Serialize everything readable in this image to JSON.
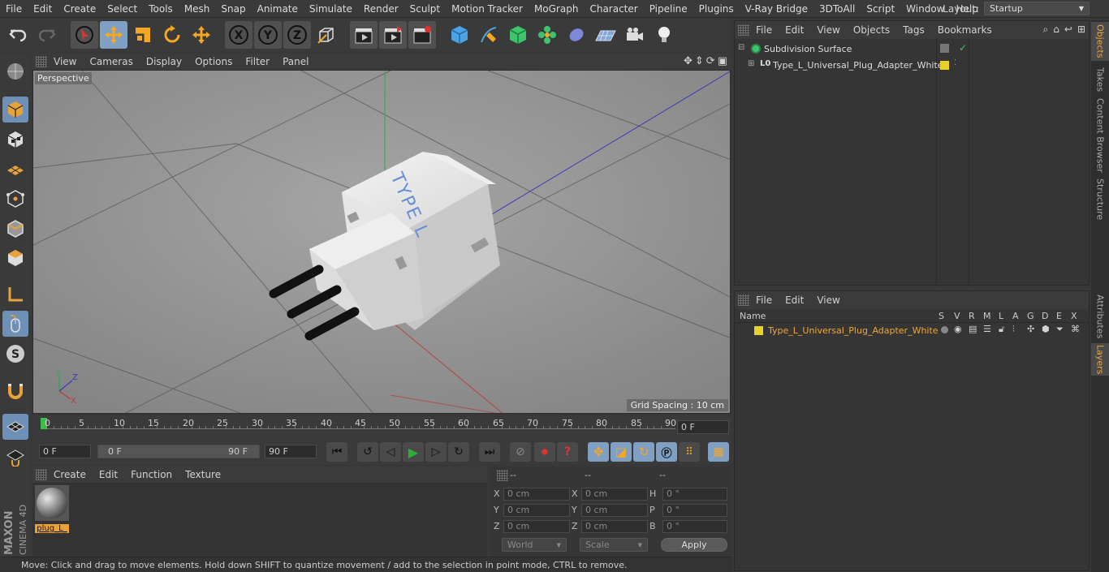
{
  "menu": [
    "File",
    "Edit",
    "Create",
    "Select",
    "Tools",
    "Mesh",
    "Snap",
    "Animate",
    "Simulate",
    "Render",
    "Sculpt",
    "Motion Tracker",
    "MoGraph",
    "Character",
    "Pipeline",
    "Plugins",
    "V-Ray Bridge",
    "3DToAll",
    "Script",
    "Window",
    "Help"
  ],
  "layout": {
    "label": "Layout:",
    "value": "Startup"
  },
  "viewport": {
    "menu": [
      "View",
      "Cameras",
      "Display",
      "Options",
      "Filter",
      "Panel"
    ],
    "label": "Perspective",
    "grid_spacing": "Grid Spacing : 10 cm",
    "model_text": "TYPE L",
    "axis": {
      "x": "X",
      "y": "Y",
      "z": "Z"
    }
  },
  "timeline": {
    "ticks": [
      "0",
      "5",
      "10",
      "15",
      "20",
      "25",
      "30",
      "35",
      "40",
      "45",
      "50",
      "55",
      "60",
      "65",
      "70",
      "75",
      "80",
      "85",
      "90"
    ],
    "current_frame": "0 F"
  },
  "transport": {
    "start": "0 F",
    "range_start": "0 F",
    "range_end": "90 F",
    "end": "90 F"
  },
  "material": {
    "menu": [
      "Create",
      "Edit",
      "Function",
      "Texture"
    ],
    "item": "plug_L_"
  },
  "coords": {
    "headers": [
      "--",
      "--",
      "--"
    ],
    "rows": [
      {
        "a": "X",
        "av": "0 cm",
        "b": "X",
        "bv": "0 cm",
        "c": "H",
        "cv": "0 °"
      },
      {
        "a": "Y",
        "av": "0 cm",
        "b": "Y",
        "bv": "0 cm",
        "c": "P",
        "cv": "0 °"
      },
      {
        "a": "Z",
        "av": "0 cm",
        "b": "Z",
        "bv": "0 cm",
        "c": "B",
        "cv": "0 °"
      }
    ],
    "space": "World",
    "mode": "Scale",
    "apply": "Apply"
  },
  "status": "Move: Click and drag to move elements. Hold down SHIFT to quantize movement / add to the selection in point mode, CTRL to remove.",
  "objects": {
    "menu": [
      "File",
      "Edit",
      "View",
      "Objects",
      "Tags",
      "Bookmarks"
    ],
    "items": [
      {
        "name": "Subdivision Surface"
      },
      {
        "name": "Type_L_Universal_Plug_Adapter_White",
        "badge": "L0"
      }
    ]
  },
  "layers": {
    "menu": [
      "File",
      "Edit",
      "View"
    ],
    "headers": [
      "Name",
      "S",
      "V",
      "R",
      "M",
      "L",
      "A",
      "G",
      "D",
      "E",
      "X"
    ],
    "item": "Type_L_Universal_Plug_Adapter_White"
  },
  "right_tabs": [
    "Objects",
    "Takes",
    "Content Browser",
    "Structure",
    "Attributes",
    "Layers"
  ],
  "brand": {
    "line1": "MAXON",
    "line2": "CINEMA 4D"
  },
  "colors": {
    "accent": "#7f9fc3",
    "layer_yellow": "#e8d12a",
    "layer_text": "#f0a830",
    "highlight": "#e6a84a"
  }
}
